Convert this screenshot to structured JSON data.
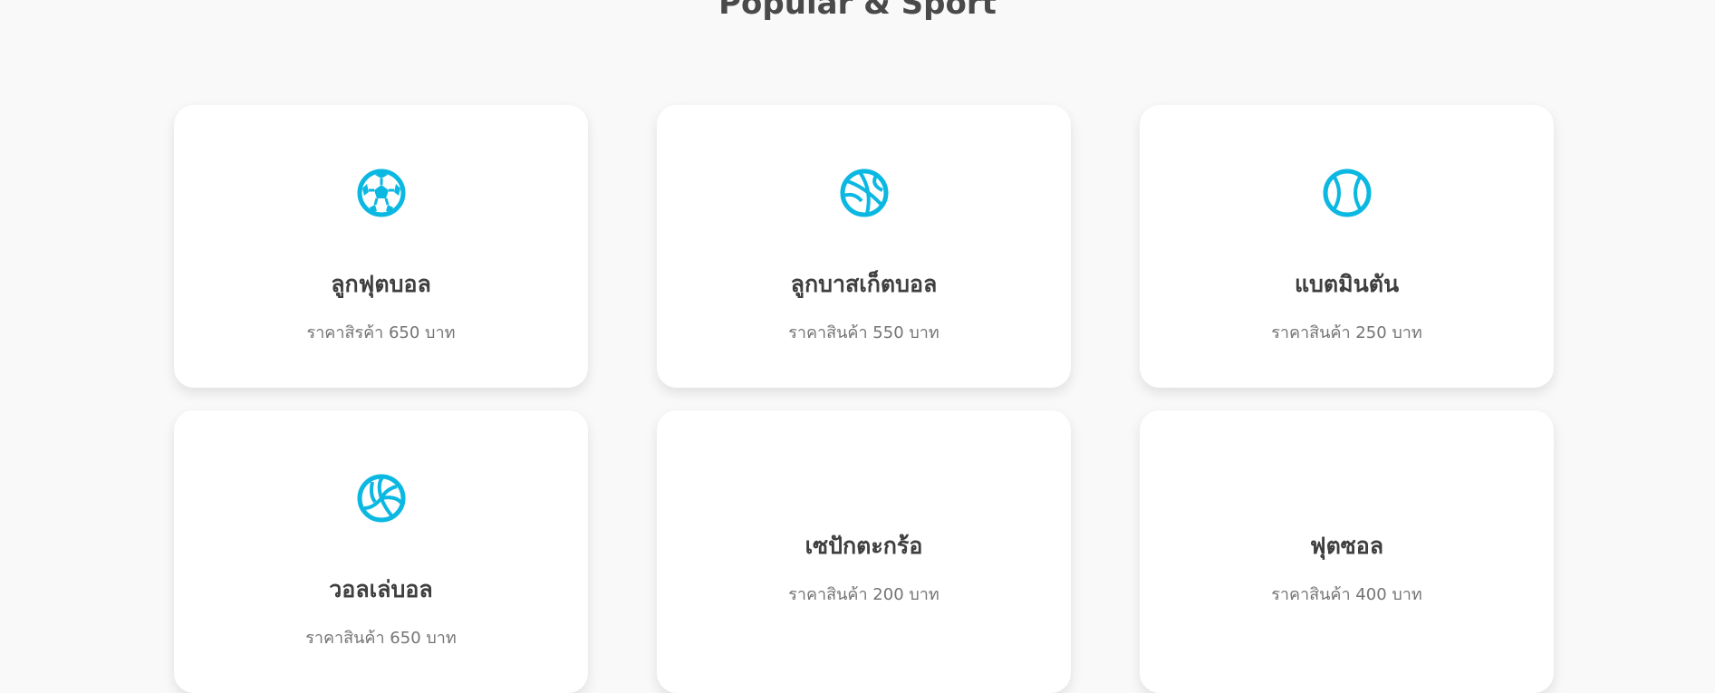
{
  "section": {
    "title": "Popular & Sport"
  },
  "accent_color": "#0bb8e2",
  "products": [
    {
      "name": "ลูกฟุตบอล",
      "price": "ราคาสิรค้า 650 บาท",
      "icon": "soccer-ball-icon"
    },
    {
      "name": "ลูกบาสเก็ตบอล",
      "price": "ราคาสินค้า 550 บาท",
      "icon": "basketball-icon"
    },
    {
      "name": "แบตมินตัน",
      "price": "ราคาสินค้า 250 บาท",
      "icon": "tennis-ball-icon"
    },
    {
      "name": "วอลเล่บอล",
      "price": "ราคาสินค้า 650 บาท",
      "icon": "volleyball-icon"
    },
    {
      "name": "เซปักตะกร้อ",
      "price": "ราคาสินค้า 200 บาท",
      "icon": ""
    },
    {
      "name": "ฟุตซอล",
      "price": "ราคาสินค้า 400 บาท",
      "icon": ""
    }
  ]
}
